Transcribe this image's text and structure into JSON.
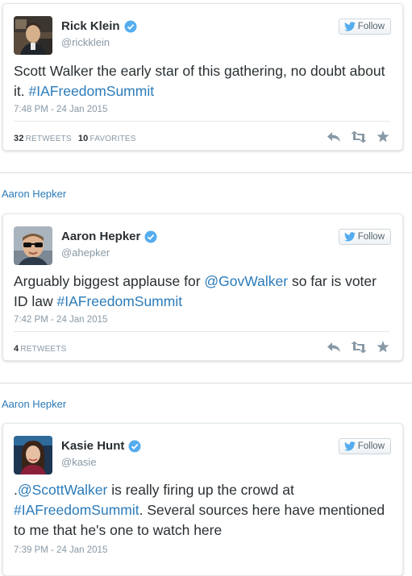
{
  "tweets": [
    {
      "name": "Rick Klein",
      "handle": "@rickklein",
      "follow_label": "Follow",
      "text_parts": [
        {
          "text": "Scott Walker the early star of this gathering, no doubt about it. ",
          "link": false
        },
        {
          "text": "#IAFreedomSummit",
          "link": true
        }
      ],
      "timestamp": "7:48 PM - 24 Jan 2015",
      "retweets_count": "32",
      "retweets_label": "RETWEETS",
      "favorites_count": "10",
      "favorites_label": "FAVORITES"
    },
    {
      "attribution": "Aaron Hepker",
      "name": "Aaron Hepker",
      "handle": "@ahepker",
      "follow_label": "Follow",
      "text_parts": [
        {
          "text": "Arguably biggest applause for ",
          "link": false
        },
        {
          "text": "@GovWalker",
          "link": true
        },
        {
          "text": " so far is voter ID law ",
          "link": false
        },
        {
          "text": "#IAFreedomSummit",
          "link": true
        }
      ],
      "timestamp": "7:42 PM - 24 Jan 2015",
      "retweets_count": "4",
      "retweets_label": "RETWEETS"
    },
    {
      "attribution": "Aaron Hepker",
      "name": "Kasie Hunt",
      "handle": "@kasie",
      "follow_label": "Follow",
      "text_parts": [
        {
          "text": ".",
          "link": false
        },
        {
          "text": "@ScottWalker",
          "link": true
        },
        {
          "text": " is really firing up the crowd at ",
          "link": false
        },
        {
          "text": "#IAFreedomSummit",
          "link": true
        },
        {
          "text": ". Several sources here have mentioned to me that he's one to watch here",
          "link": false
        }
      ],
      "timestamp": "7:39 PM - 24 Jan 2015"
    }
  ],
  "colors": {
    "link": "#2b7bb9",
    "verified": "#55acee",
    "muted": "#8899a6",
    "text": "#292f33"
  },
  "icons": [
    "verified-badge-icon",
    "twitter-bird-icon",
    "reply-icon",
    "retweet-icon",
    "favorite-star-icon"
  ]
}
